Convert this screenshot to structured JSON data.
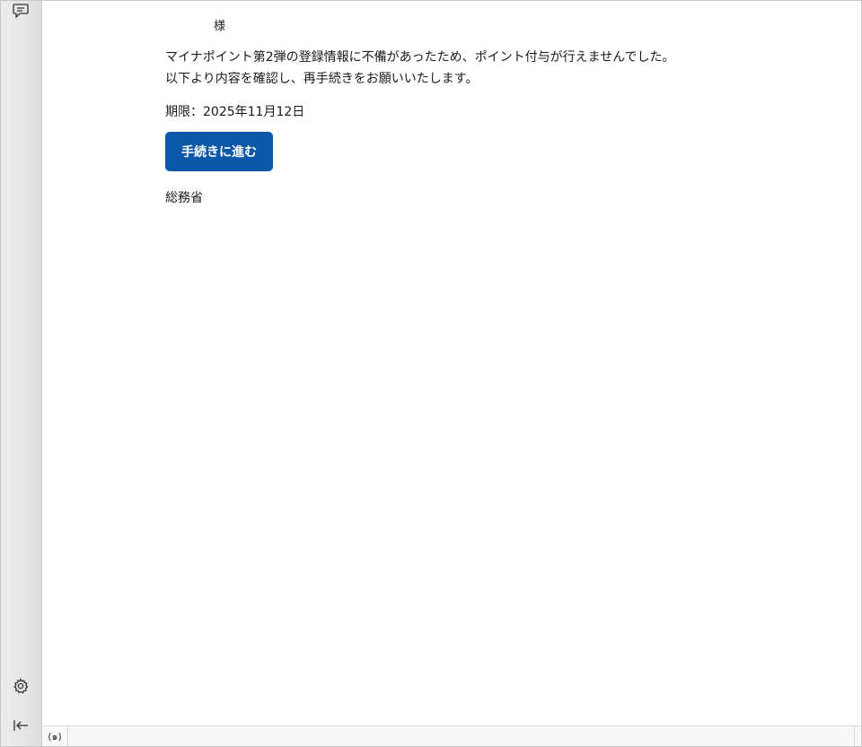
{
  "sidebar": {
    "icons": [
      "chat-icon",
      "gear-icon",
      "collapse-left-icon"
    ]
  },
  "email": {
    "greeting": "様",
    "message_line1": "マイナポイント第2弾の登録情報に不備があったため、ポイント付与が行えませんでした。",
    "message_line2": "以下より内容を確認し、再手続きをお願いいたします。",
    "deadline": "期限：2025年11月12日",
    "button_label": "手続きに進む",
    "button_color": "#0b57a8",
    "sender": "総務省"
  },
  "statusbar": {
    "signal_glyph": "(๑)",
    "signal_icon": "broadcast-icon"
  }
}
